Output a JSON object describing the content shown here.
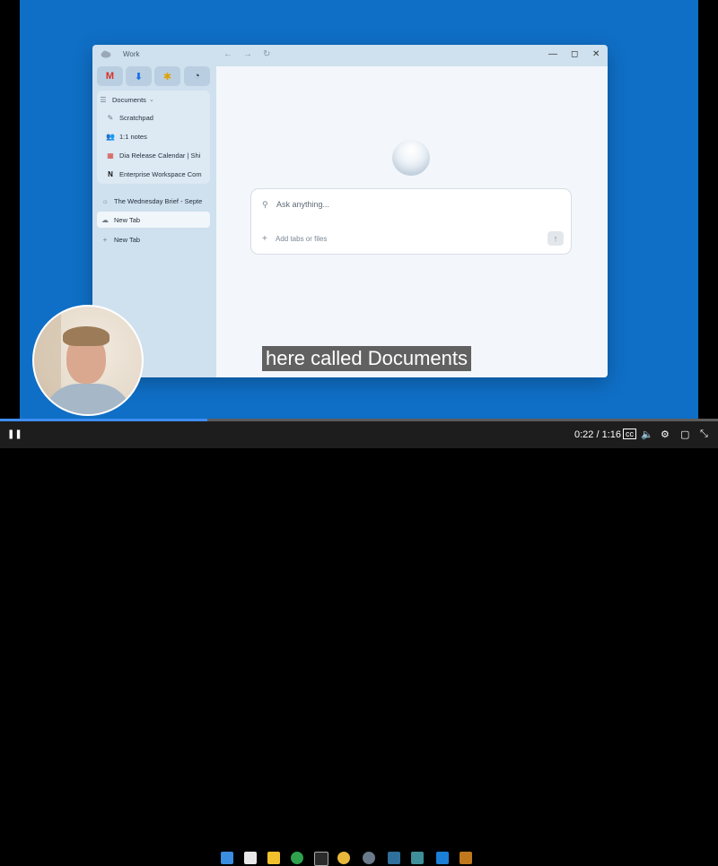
{
  "window": {
    "title": "Work",
    "controls": {
      "minimize": "—",
      "maximize": "◻",
      "close": "✕"
    },
    "nav": {
      "back": "←",
      "forward": "→",
      "reload": "↻"
    }
  },
  "pinned_tabs": [
    {
      "label": "M",
      "color": "#d93025"
    },
    {
      "label": "⬇",
      "color": "#1a73e8"
    },
    {
      "label": "✱",
      "color": "#e2a100"
    },
    {
      "label": "◔",
      "color": "#333333"
    }
  ],
  "sidebar": {
    "folder": {
      "label": "Documents"
    },
    "folder_items": [
      {
        "label": "Scratchpad",
        "icon": "✎"
      },
      {
        "label": "1:1 notes",
        "icon": "👥"
      },
      {
        "label": "Dia Release Calendar | Shi",
        "icon": "▦"
      },
      {
        "label": "Enterprise Workspace Com",
        "icon": "N"
      }
    ],
    "items": [
      {
        "label": "The Wednesday Brief - Septe",
        "icon": "☼"
      },
      {
        "label": "New Tab",
        "icon": "☁"
      },
      {
        "label": "New Tab",
        "icon": "+"
      }
    ]
  },
  "ask": {
    "placeholder": "Ask anything...",
    "add_label": "Add tabs or files",
    "send": "↑"
  },
  "caption": "here called Documents",
  "video": {
    "time": "0:22 / 1:16",
    "progress": 0.289,
    "play_pause": "❚❚"
  },
  "colors": {
    "background": "#0f6fc6",
    "accent": "#3e8ef7"
  }
}
